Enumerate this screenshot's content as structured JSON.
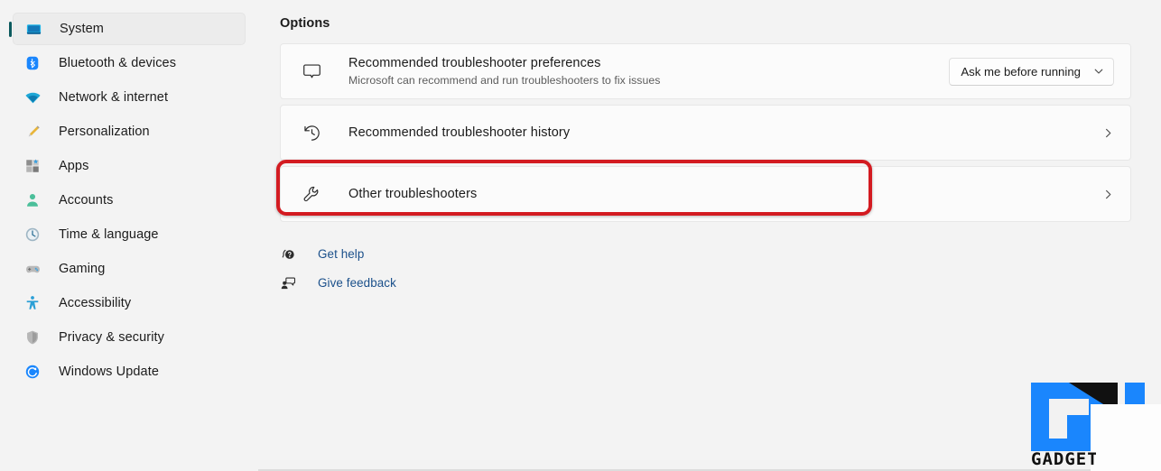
{
  "sidebar": {
    "items": [
      {
        "label": "System",
        "icon": "monitor-icon",
        "selected": true
      },
      {
        "label": "Bluetooth & devices",
        "icon": "bluetooth-icon",
        "selected": false
      },
      {
        "label": "Network & internet",
        "icon": "wifi-icon",
        "selected": false
      },
      {
        "label": "Personalization",
        "icon": "brush-icon",
        "selected": false
      },
      {
        "label": "Apps",
        "icon": "apps-icon",
        "selected": false
      },
      {
        "label": "Accounts",
        "icon": "person-icon",
        "selected": false
      },
      {
        "label": "Time & language",
        "icon": "clock-icon",
        "selected": false
      },
      {
        "label": "Gaming",
        "icon": "gamepad-icon",
        "selected": false
      },
      {
        "label": "Accessibility",
        "icon": "accessibility-icon",
        "selected": false
      },
      {
        "label": "Privacy & security",
        "icon": "shield-icon",
        "selected": false
      },
      {
        "label": "Windows Update",
        "icon": "update-icon",
        "selected": false
      }
    ]
  },
  "main": {
    "page_title": "Options",
    "cards": [
      {
        "title": "Recommended troubleshooter preferences",
        "subtitle": "Microsoft can recommend and run troubleshooters to fix issues",
        "icon": "speech-bubble-icon",
        "control": "dropdown",
        "dropdown_value": "Ask me before running",
        "highlighted": false
      },
      {
        "title": "Recommended troubleshooter history",
        "subtitle": "",
        "icon": "history-clock-icon",
        "control": "chevron",
        "dropdown_value": "",
        "highlighted": false
      },
      {
        "title": "Other troubleshooters",
        "subtitle": "",
        "icon": "wrench-icon",
        "control": "chevron",
        "dropdown_value": "",
        "highlighted": true
      }
    ],
    "links": [
      {
        "label": "Get help",
        "icon": "help-question-icon"
      },
      {
        "label": "Give feedback",
        "icon": "feedback-person-icon"
      }
    ]
  },
  "watermark": {
    "text": "GADGETS",
    "brand_color": "#1a86fd"
  },
  "colors": {
    "accent_bar": "#0c5a5e",
    "highlight_red": "#d31b21",
    "link_blue": "#1a4f8a",
    "page_bg": "#f3f3f3",
    "card_bg": "#fbfbfb"
  }
}
